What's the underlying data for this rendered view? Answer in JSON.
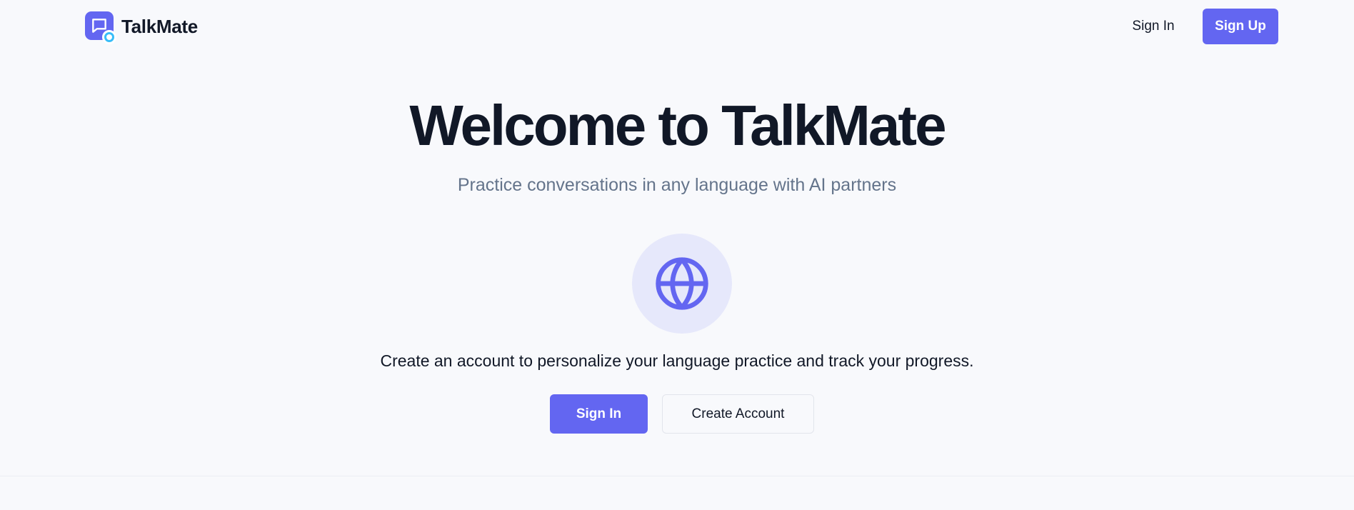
{
  "header": {
    "brand_name": "TalkMate",
    "sign_in_label": "Sign In",
    "sign_up_label": "Sign Up"
  },
  "hero": {
    "title": "Welcome to TalkMate",
    "subtitle": "Practice conversations in any language with AI partners",
    "icon": "globe-icon",
    "description": "Create an account to personalize your language practice and track your progress.",
    "sign_in_label": "Sign In",
    "create_account_label": "Create Account"
  },
  "colors": {
    "accent": "#6366f1",
    "logo_badge": "#38bdf8",
    "background": "#f8f9fc",
    "globe_bg": "#e6e8fb",
    "subtitle_text": "#64748b",
    "primary_text": "#111827"
  },
  "icons": {
    "logo": "chat-bubble-icon",
    "logo_badge": "status-dot-icon",
    "hero": "globe-icon"
  }
}
